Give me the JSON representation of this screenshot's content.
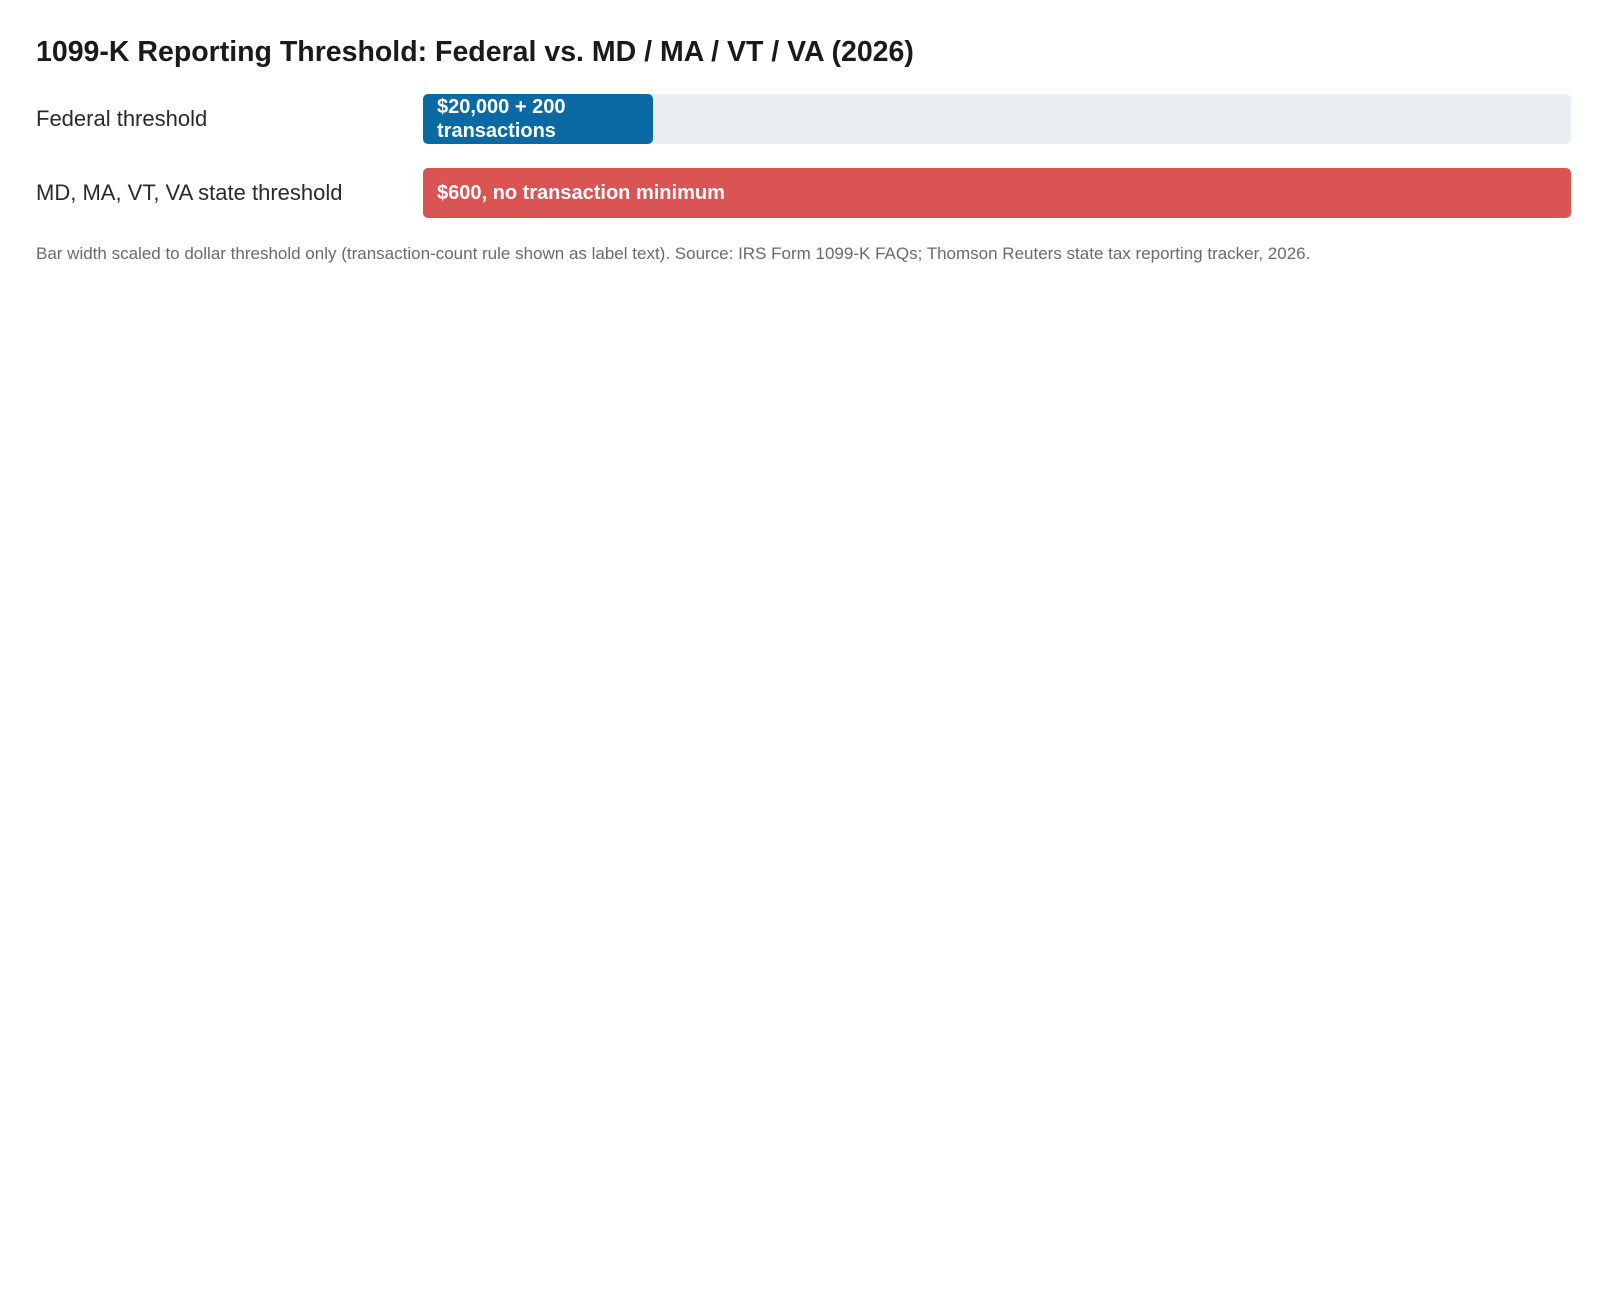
{
  "chart_data": {
    "type": "bar",
    "orientation": "horizontal",
    "title": "1099-K Reporting Threshold: Federal vs. MD / MA / VT / VA (2026)",
    "categories": [
      "Federal threshold",
      "MD, MA, VT, VA state threshold"
    ],
    "values": [
      20000,
      600
    ],
    "value_labels": [
      "$20,000 + 200 transactions",
      "$600, no transaction minimum"
    ],
    "colors": [
      "#0b69a3",
      "#d95452"
    ],
    "track_color": "#eceff2",
    "display_fill_fraction": [
      0.2,
      1.0
    ],
    "legend": "none",
    "grid": false,
    "footnote": "Bar width scaled to dollar threshold only (transaction-count rule shown as label text). Source: IRS Form 1099-K FAQs; Thomson Reuters state tax reporting tracker, 2026."
  }
}
